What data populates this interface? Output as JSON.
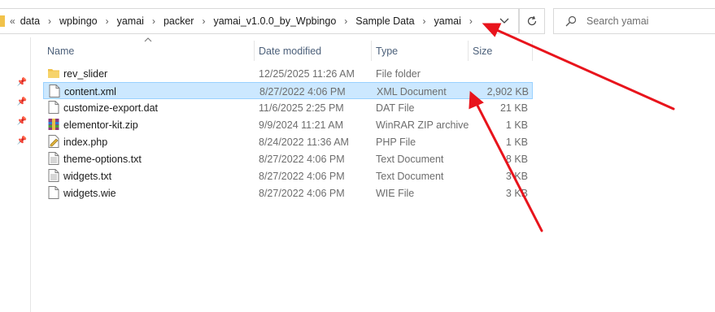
{
  "address_bar": {
    "overflow_label": "«",
    "crumbs": [
      "data",
      "wpbingo",
      "yamai",
      "packer",
      "yamai_v1.0.0_by_Wpbingo",
      "Sample Data",
      "yamai"
    ],
    "separator": "›"
  },
  "search": {
    "placeholder": "Search yamai"
  },
  "columns": {
    "name": "Name",
    "date": "Date modified",
    "type": "Type",
    "size": "Size"
  },
  "files": [
    {
      "name": "rev_slider",
      "date": "12/25/2025 11:26 AM",
      "type": "File folder",
      "size": "",
      "icon": "folder-icon"
    },
    {
      "name": "content.xml",
      "date": "8/27/2022 4:06 PM",
      "type": "XML Document",
      "size": "2,902 KB",
      "icon": "xml-file-icon",
      "selected": true
    },
    {
      "name": "customize-export.dat",
      "date": "11/6/2025 2:25 PM",
      "type": "DAT File",
      "size": "21 KB",
      "icon": "dat-file-icon"
    },
    {
      "name": "elementor-kit.zip",
      "date": "9/9/2024 11:21 AM",
      "type": "WinRAR ZIP archive",
      "size": "1 KB",
      "icon": "winrar-zip-icon"
    },
    {
      "name": "index.php",
      "date": "8/24/2022 11:36 AM",
      "type": "PHP File",
      "size": "1 KB",
      "icon": "php-file-icon"
    },
    {
      "name": "theme-options.txt",
      "date": "8/27/2022 4:06 PM",
      "type": "Text Document",
      "size": "8 KB",
      "icon": "text-file-icon"
    },
    {
      "name": "widgets.txt",
      "date": "8/27/2022 4:06 PM",
      "type": "Text Document",
      "size": "3 KB",
      "icon": "text-file-icon"
    },
    {
      "name": "widgets.wie",
      "date": "8/27/2022 4:06 PM",
      "type": "WIE File",
      "size": "3 KB",
      "icon": "wie-file-icon"
    }
  ],
  "colors": {
    "selection_bg": "#cce8ff",
    "selection_border": "#99d1ff",
    "annotation_arrow": "#e8141c",
    "folder_yellow": "#f1c24a"
  }
}
